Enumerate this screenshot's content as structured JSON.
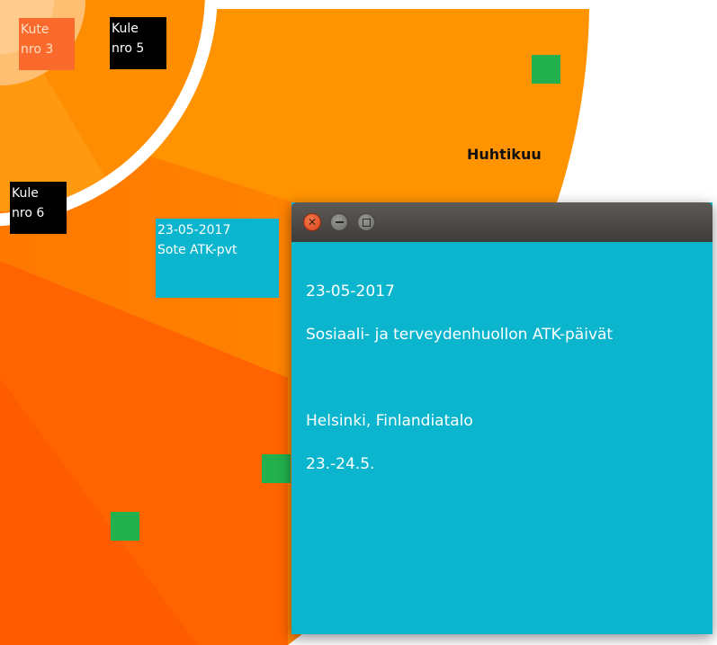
{
  "colors": {
    "outer_ring": "#ff9100",
    "mid_segment": "#ff7a00",
    "inner_segment": "#ff5f00",
    "center_light": "#ffb347",
    "label_black": "#000000",
    "label_orange": "#f96a2c",
    "label_cyan": "#0ab5cd",
    "marker_green": "#22b14c",
    "window_bg": "#0ab5cd"
  },
  "wheel": {
    "labels": [
      {
        "id": "kute-3",
        "text": "Kute\nnro 3"
      },
      {
        "id": "kule-5",
        "text": "Kule\nnro 5"
      },
      {
        "id": "kule-6",
        "text": "Kule\nnro 6"
      }
    ],
    "event_label": {
      "text": "23-05-2017\nSote ATK-pvt"
    },
    "month_label": "Huhtikuu"
  },
  "event_window": {
    "controls": {
      "close_icon": "close-icon",
      "minimize_icon": "minimize-icon",
      "maximize_icon": "maximize-icon"
    },
    "date": "23-05-2017",
    "title": "Sosiaali- ja terveydenhuollon ATK-päivät",
    "location": "Helsinki, Finlandiatalo",
    "dates": "23.-24.5."
  }
}
